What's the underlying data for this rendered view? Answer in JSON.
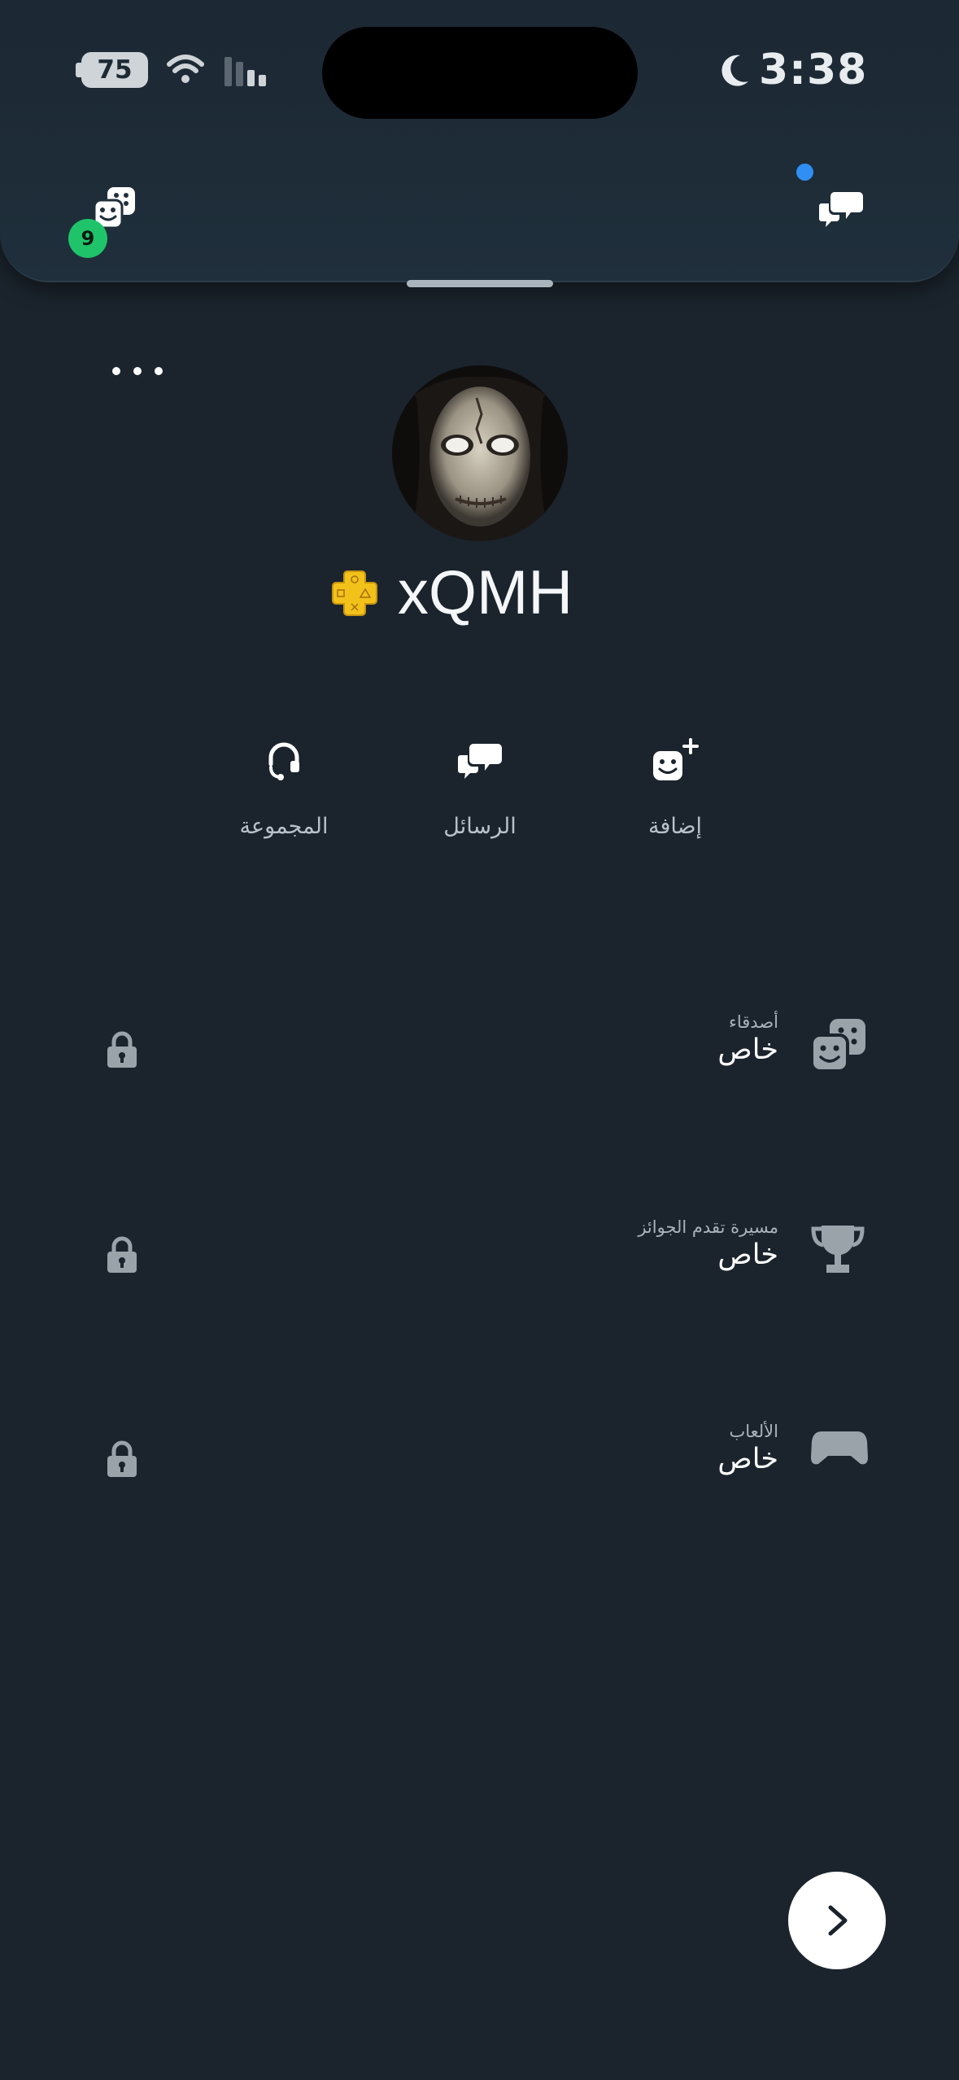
{
  "status_bar": {
    "battery": "75",
    "time": "3:38"
  },
  "header": {
    "friends_badge_count": "9",
    "unread_indicator_color": "#2f8ff3"
  },
  "profile": {
    "username": "xQMH",
    "ps_plus": true
  },
  "actions": [
    {
      "label": "إضافة",
      "icon": "add-friend-icon"
    },
    {
      "label": "الرسائل",
      "icon": "messages-icon"
    },
    {
      "label": "المجموعة",
      "icon": "party-headset-icon"
    }
  ],
  "sections": [
    {
      "caption": "أصدقاء",
      "value": "خاص",
      "icon": "friends-icon"
    },
    {
      "caption": "مسيرة تقدم الجوائز",
      "value": "خاص",
      "icon": "trophy-icon"
    },
    {
      "caption": "الألعاب",
      "value": "خاص",
      "icon": "controller-icon"
    }
  ],
  "colors": {
    "background": "#1b242d",
    "badge_green": "#1fc46a",
    "ps_plus_gold": "#f2c21b"
  }
}
